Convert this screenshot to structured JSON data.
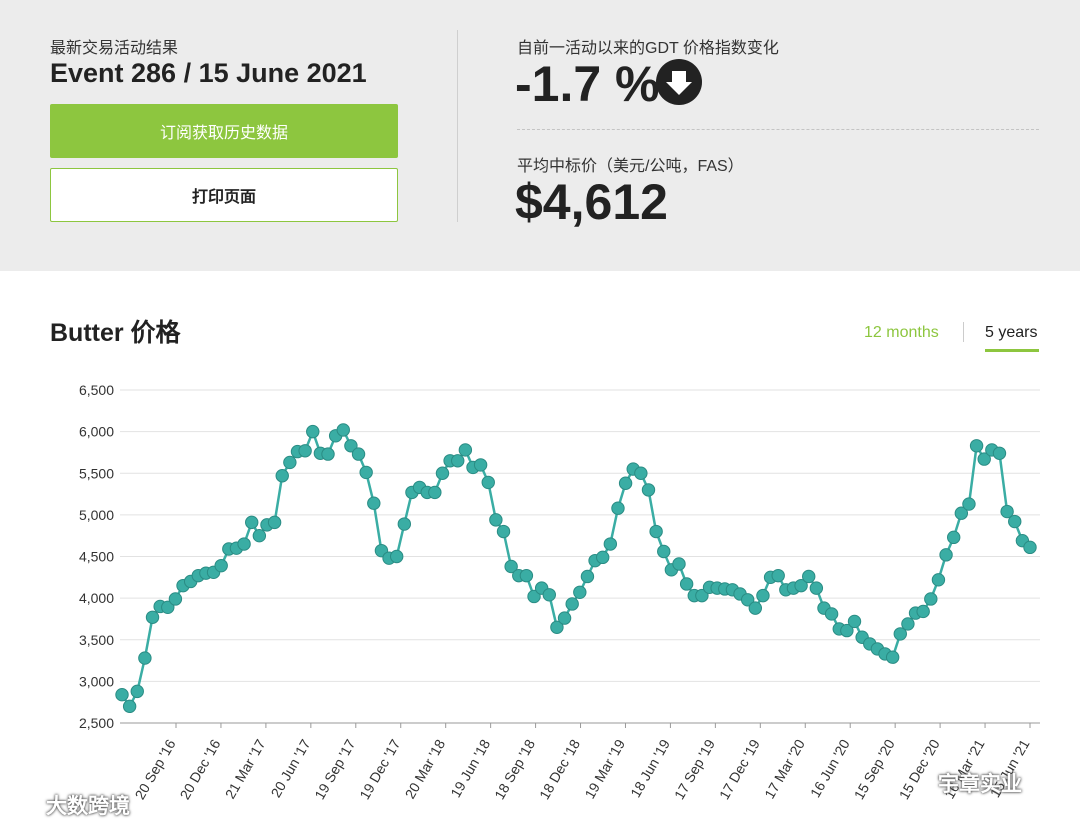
{
  "header": {
    "event_caption": "最新交易活动结果",
    "event_title": "Event 286 / 15 June 2021",
    "subscribe_label": "订阅获取历史数据",
    "print_label": "打印页面",
    "change_caption": "自前一活动以来的GDT 价格指数变化",
    "change_value": "-1.7 %",
    "change_icon": "arrow-down-circle-icon",
    "avg_caption": "平均中标价（美元/公吨，FAS）",
    "avg_value": "$4,612"
  },
  "chart_title": "Butter 价格",
  "tabs": {
    "months_label": "12 months",
    "years_label": "5 years",
    "active": "5 years"
  },
  "colors": {
    "accent": "#8dc63f",
    "series": "#3aada4",
    "panel": "#ececec"
  },
  "watermarks": {
    "left": "大数跨境",
    "right": "宇章实业"
  },
  "chart_data": {
    "type": "line",
    "ylim": [
      2500,
      6500
    ],
    "yticks": [
      2500,
      3000,
      3500,
      4000,
      4500,
      5000,
      5500,
      6000
    ],
    "ytick_labels": [
      "2,500",
      "3,000",
      "3,500",
      "4,000",
      "4,500",
      "5,000",
      "5,500",
      "6,000",
      "6,500"
    ],
    "x_labels": [
      "20 Sep '16",
      "20 Dec '16",
      "21 Mar '17",
      "20 Jun '17",
      "19 Sep '17",
      "19 Dec '17",
      "20 Mar '18",
      "19 Jun '18",
      "18 Sep '18",
      "18 Dec '18",
      "19 Mar '19",
      "18 Jun '19",
      "17 Sep '19",
      "17 Dec '19",
      "17 Mar '20",
      "16 Jun '20",
      "15 Sep '20",
      "15 Dec '20",
      "16 Mar '21",
      "15 Jun '21"
    ],
    "grid": true,
    "values": [
      2840,
      2700,
      2880,
      3280,
      3770,
      3900,
      3890,
      3990,
      4150,
      4200,
      4270,
      4300,
      4310,
      4390,
      4590,
      4600,
      4650,
      4910,
      4750,
      4880,
      4910,
      5470,
      5630,
      5760,
      5770,
      6000,
      5740,
      5730,
      5950,
      6020,
      5830,
      5730,
      5510,
      5140,
      4570,
      4480,
      4500,
      4890,
      5270,
      5330,
      5270,
      5270,
      5500,
      5650,
      5650,
      5780,
      5570,
      5600,
      5390,
      4940,
      4800,
      4380,
      4270,
      4270,
      4020,
      4120,
      4040,
      3650,
      3760,
      3930,
      4070,
      4260,
      4450,
      4490,
      4650,
      5080,
      5380,
      5550,
      5500,
      5300,
      4800,
      4560,
      4340,
      4410,
      4170,
      4030,
      4030,
      4130,
      4120,
      4110,
      4100,
      4050,
      3980,
      3880,
      4030,
      4250,
      4270,
      4100,
      4120,
      4150,
      4260,
      4120,
      3880,
      3810,
      3630,
      3610,
      3720,
      3530,
      3450,
      3390,
      3330,
      3290,
      3570,
      3690,
      3820,
      3840,
      3990,
      4220,
      4520,
      4730,
      5020,
      5130,
      5830,
      5670,
      5780,
      5740,
      5040,
      4920,
      4690,
      4610
    ]
  }
}
